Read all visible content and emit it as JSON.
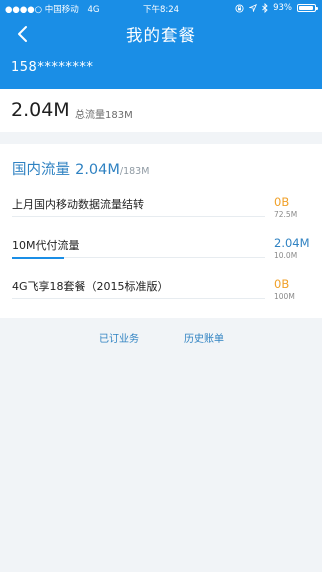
{
  "status_bar": {
    "signal": "●●●●○",
    "carrier": "中国移动",
    "network": "4G",
    "time": "下午8:24",
    "icons": [
      "orientation-lock-icon",
      "location-icon",
      "bluetooth-icon"
    ],
    "battery_percent": "93%",
    "battery_level": 0.93
  },
  "header": {
    "title": "我的套餐",
    "back_icon": "chevron-left-icon",
    "phone_masked": "158********"
  },
  "summary": {
    "used": "2.04M",
    "total_label": "总流量183M"
  },
  "domestic": {
    "title_prefix": "国内流量",
    "used": "2.04M",
    "total": "/183M",
    "items": [
      {
        "name": "上月国内移动数据流量结转",
        "used": "0B",
        "total": "72.5M",
        "color": "#f0a028",
        "progress": 0
      },
      {
        "name": "10M代付流量",
        "used": "2.04M",
        "total": "10.0M",
        "color": "#2f82c2",
        "progress": 0.204
      },
      {
        "name": "4G飞享18套餐（2015标准版）",
        "used": "0B",
        "total": "100M",
        "color": "#f0a028",
        "progress": 0
      }
    ]
  },
  "links": {
    "subscribed": "已订业务",
    "history": "历史账单"
  },
  "colors": {
    "primary": "#1a8ee6",
    "accent_blue": "#2f82c2",
    "accent_orange": "#f0a028",
    "background": "#f1f4f7"
  }
}
